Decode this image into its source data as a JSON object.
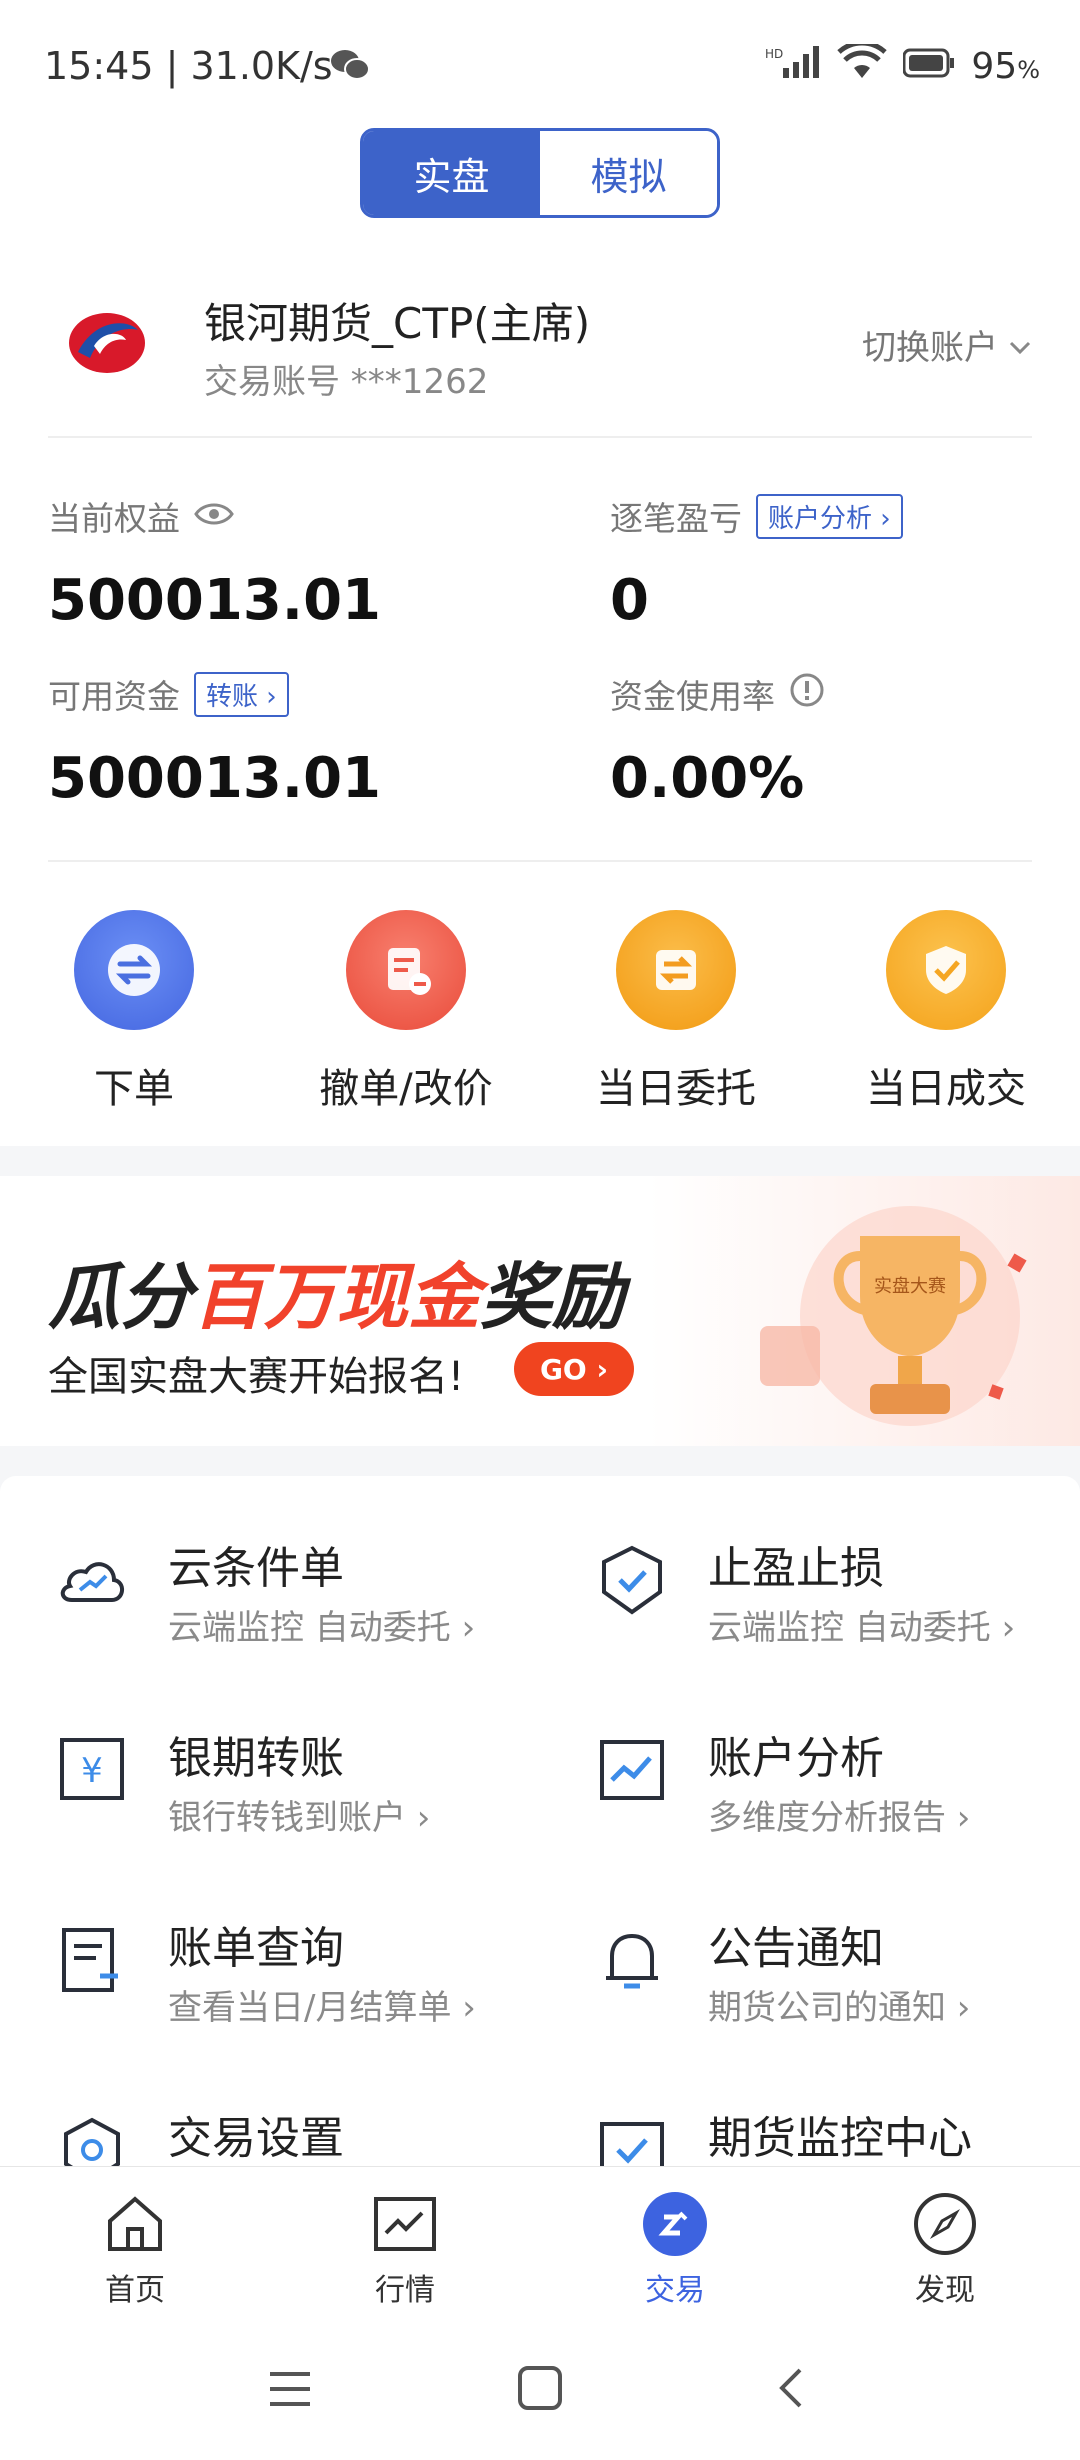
{
  "status_bar": {
    "time": "15:45 | 31.0K/s",
    "battery": "95"
  },
  "segmented": {
    "real": "实盘",
    "sim": "模拟"
  },
  "account": {
    "name": "银河期货_CTP(主席)",
    "number": "交易账号 ***1262",
    "switch_label": "切换账户"
  },
  "metrics": {
    "equity_label": "当前权益",
    "equity_value": "500013.01",
    "pnl_label": "逐笔盈亏",
    "pnl_tag": "账户分析",
    "pnl_value": "0",
    "available_label": "可用资金",
    "available_tag": "转账",
    "available_value": "500013.01",
    "usage_label": "资金使用率",
    "usage_value": "0.00%"
  },
  "quick_actions": [
    {
      "label": "下单",
      "color": "#4c73e8"
    },
    {
      "label": "撤单/改价",
      "color": "#ee5a4a"
    },
    {
      "label": "当日委托",
      "color": "#f39c1f"
    },
    {
      "label": "当日成交",
      "color": "#f5a623"
    }
  ],
  "banner": {
    "line1_a": "瓜分",
    "line1_b": "百万现金",
    "line1_c": "奖励",
    "line2": "全国实盘大赛开始报名!",
    "go": "GO",
    "trophy_text": "实盘大赛"
  },
  "services": [
    {
      "title": "云条件单",
      "sub": "云端监控 自动委托",
      "icon": "cloud-icon"
    },
    {
      "title": "止盈止损",
      "sub": "云端监控 自动委托",
      "icon": "shield-check-icon"
    },
    {
      "title": "银期转账",
      "sub": "银行转钱到账户",
      "icon": "yen-transfer-icon"
    },
    {
      "title": "账户分析",
      "sub": "多维度分析报告",
      "icon": "chart-icon"
    },
    {
      "title": "账单查询",
      "sub": "查看当日/月结算单",
      "icon": "bill-icon"
    },
    {
      "title": "公告通知",
      "sub": "期货公司的通知",
      "icon": "bell-icon"
    },
    {
      "title": "交易设置",
      "sub": "",
      "icon": "settings-icon"
    },
    {
      "title": "期货监控中心",
      "sub": "",
      "icon": "monitor-icon"
    }
  ],
  "tabs": [
    {
      "label": "首页",
      "icon": "home-icon"
    },
    {
      "label": "行情",
      "icon": "market-icon"
    },
    {
      "label": "交易",
      "icon": "trade-icon",
      "active": true
    },
    {
      "label": "发现",
      "icon": "compass-icon"
    }
  ],
  "colors": {
    "primary": "#3d63c9",
    "accent_red": "#f1422b"
  }
}
